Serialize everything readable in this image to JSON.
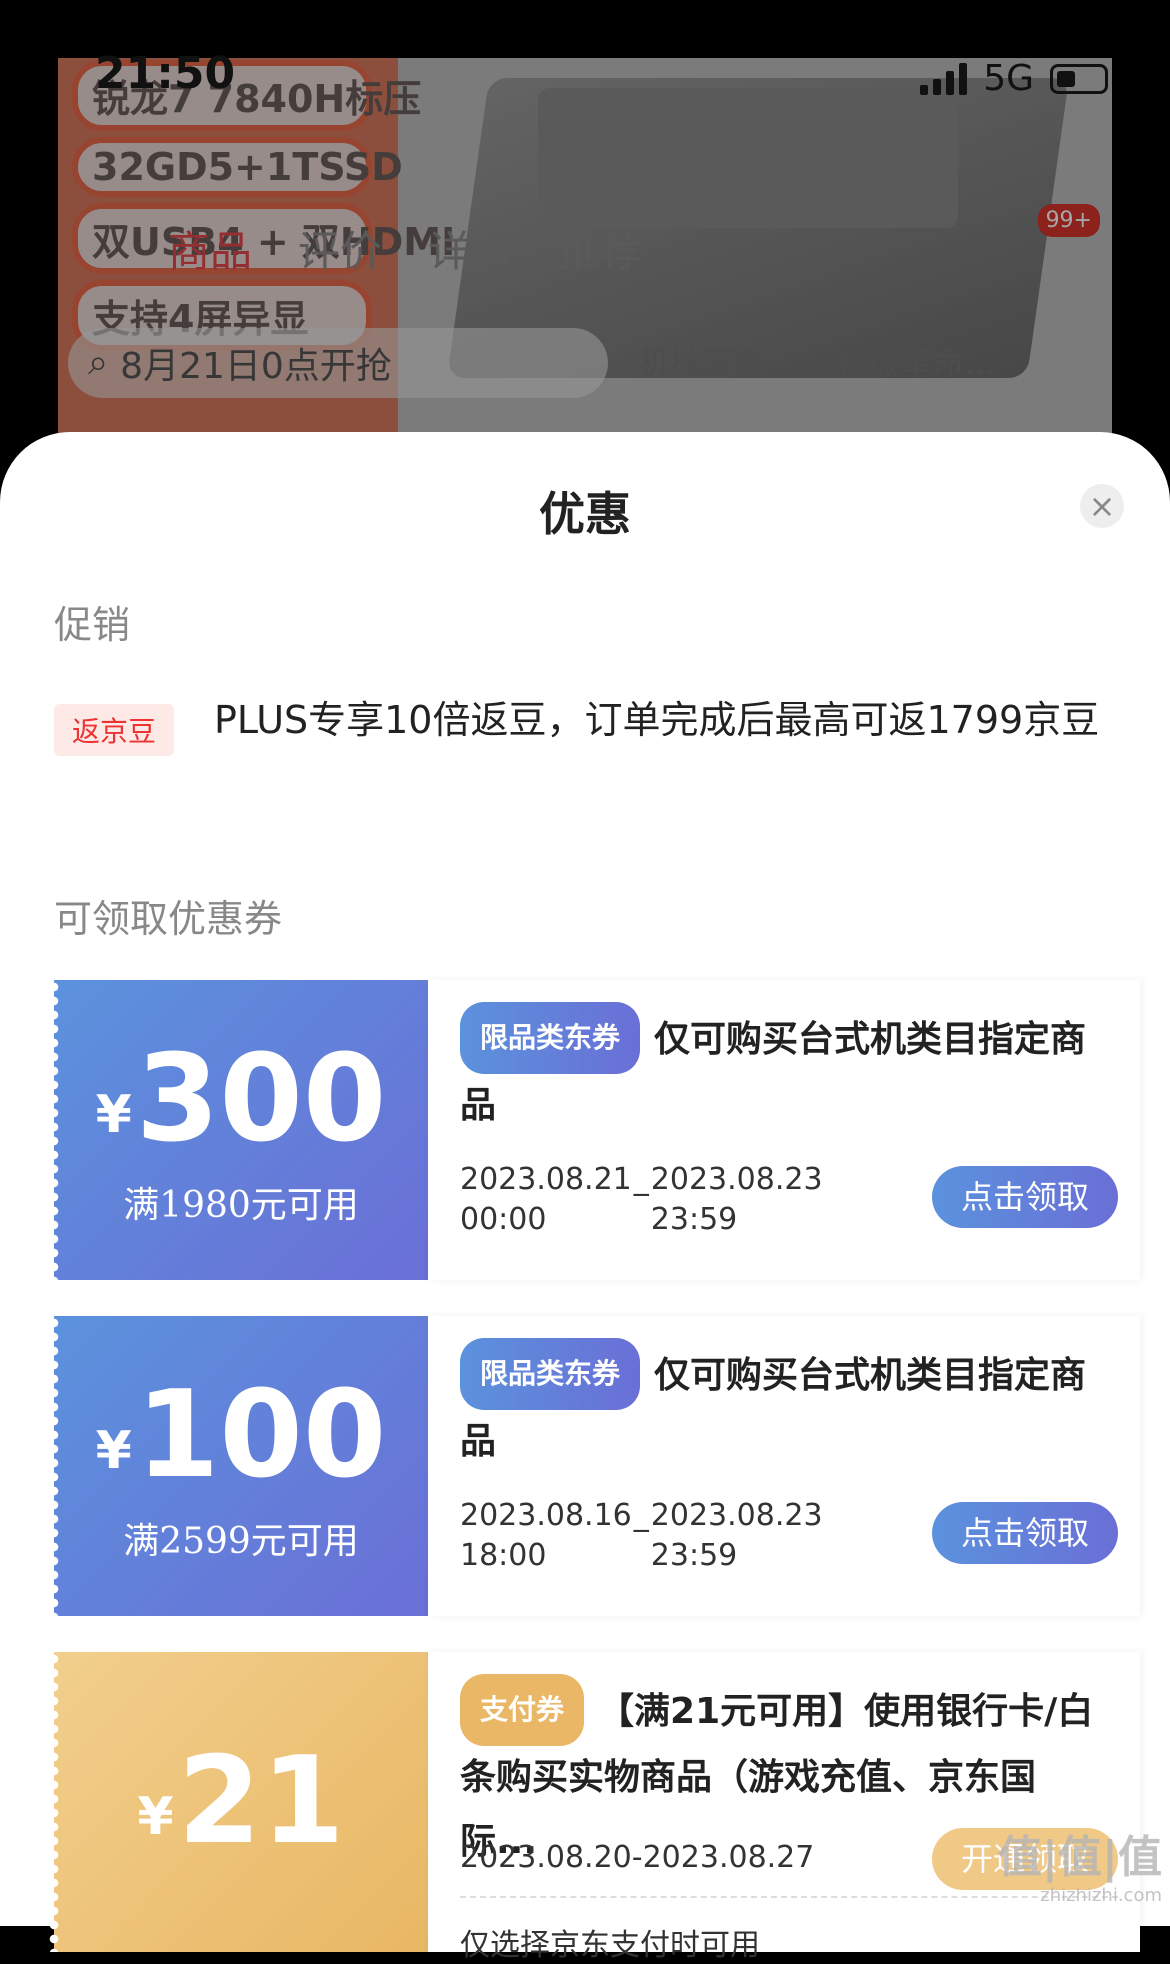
{
  "status": {
    "time": "21:50",
    "network": "5G"
  },
  "background": {
    "promo_lines": [
      "锐龙7 7840H标压",
      "32GD5+1TSSD",
      "双USB4 + 双HDMI",
      "支持4屏异显"
    ],
    "tabs": [
      "商品",
      "评价",
      "详情",
      "推荐"
    ],
    "active_tab": "商品",
    "badge": "99+",
    "search_text": "8月21日0点开抢",
    "chips": [
      "机械革命",
      "机械革命..."
    ]
  },
  "sheet": {
    "title": "优惠",
    "promo_section": "促销",
    "promo_tag": "返京豆",
    "promo_text": "PLUS专享10倍返豆，订单完成后最高可返1799京豆",
    "coupon_section": "可领取优惠券"
  },
  "coupons": [
    {
      "symbol": "¥",
      "amount": "300",
      "condition": "满1980元可用",
      "tag": "限品类东券",
      "title": "仅可购买台式机类目指定商品",
      "start_date": "2023.08.21",
      "start_time": "00:00",
      "end_date": "2023.08.23",
      "end_time": "23:59",
      "button": "点击领取"
    },
    {
      "symbol": "¥",
      "amount": "100",
      "condition": "满2599元可用",
      "tag": "限品类东券",
      "title": "仅可购买台式机类目指定商品",
      "start_date": "2023.08.16",
      "start_time": "18:00",
      "end_date": "2023.08.23",
      "end_time": "23:59",
      "button": "点击领取"
    },
    {
      "symbol": "¥",
      "amount": "21",
      "tag": "支付券",
      "title": "【满21元可用】使用银行卡/白条购买实物商品（游戏充值、京东国际...",
      "dates": "2023.08.20-2023.08.27",
      "button": "开通领取",
      "note": "仅选择京东支付时可用"
    }
  ],
  "watermark": {
    "main": "值|值|值",
    "sub": "zhizhizhi.com"
  },
  "colors": {
    "accent_blue": "#5b92dd",
    "accent_gold": "#e9b766",
    "promo_red": "#e33333"
  }
}
